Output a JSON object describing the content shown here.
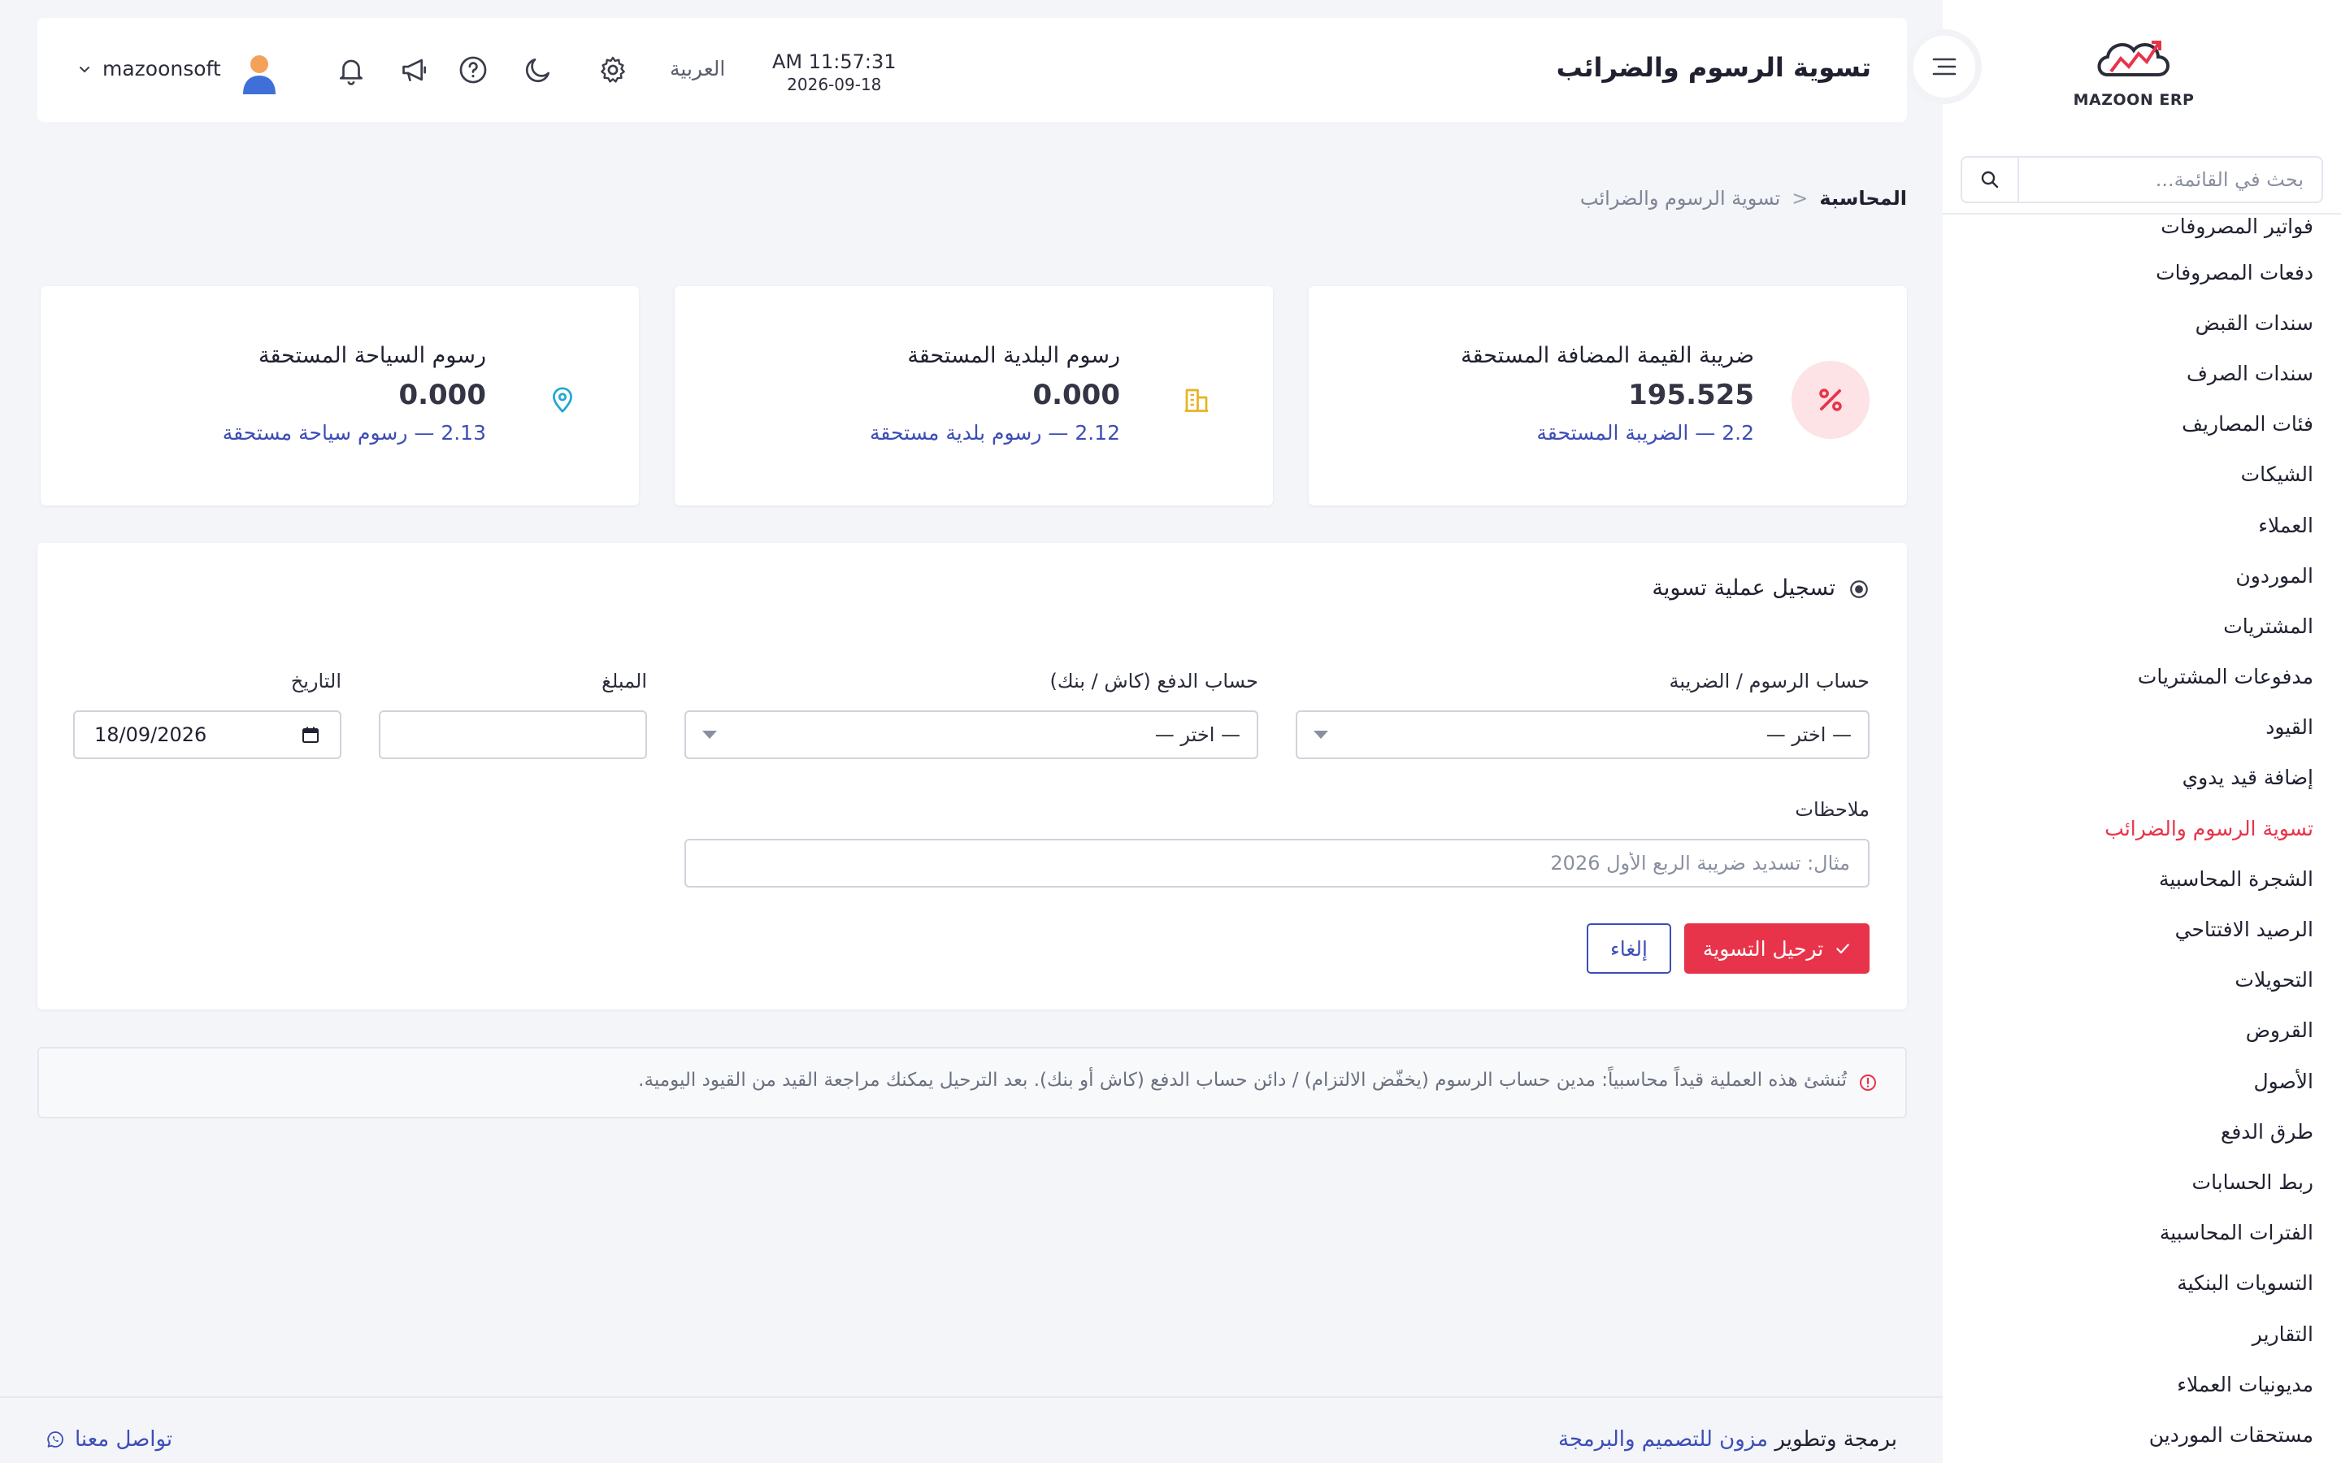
{
  "sidebar": {
    "logo_text": "MAZOON ERP",
    "search_placeholder": "بحث في القائمة...",
    "items": [
      {
        "label": "فواتير المصروفات"
      },
      {
        "label": "دفعات المصروفات"
      },
      {
        "label": "سندات القبض"
      },
      {
        "label": "سندات الصرف"
      },
      {
        "label": "فئات المصاريف"
      },
      {
        "label": "الشيكات"
      },
      {
        "label": "العملاء"
      },
      {
        "label": "الموردون"
      },
      {
        "label": "المشتريات"
      },
      {
        "label": "مدفوعات المشتريات"
      },
      {
        "label": "القيود"
      },
      {
        "label": "إضافة قيد يدوي"
      },
      {
        "label": "تسوية الرسوم والضرائب",
        "active": true
      },
      {
        "label": "الشجرة المحاسبية"
      },
      {
        "label": "الرصيد الافتتاحي"
      },
      {
        "label": "التحويلات"
      },
      {
        "label": "القروض"
      },
      {
        "label": "الأصول"
      },
      {
        "label": "طرق الدفع"
      },
      {
        "label": "ربط الحسابات"
      },
      {
        "label": "الفترات المحاسبية"
      },
      {
        "label": "التسويات البنكية"
      },
      {
        "label": "التقارير"
      },
      {
        "label": "مديونيات العملاء"
      },
      {
        "label": "مستحقات الموردين"
      }
    ]
  },
  "header": {
    "title": "تسوية الرسوم والضرائب",
    "time": "AM 11:57:31",
    "date": "2026-09-18",
    "language": "العربية",
    "username": "mazoonsoft"
  },
  "breadcrumb": {
    "root": "المحاسبة",
    "separator": "<",
    "current": "تسوية الرسوم والضرائب"
  },
  "cards": [
    {
      "title": "ضريبة القيمة المضافة المستحقة",
      "value": "195.525",
      "link": "2.2 — الضريبة المستحقة",
      "icon": "percent-icon"
    },
    {
      "title": "رسوم البلدية المستحقة",
      "value": "0.000",
      "link": "2.12 — رسوم بلدية مستحقة",
      "icon": "building-icon"
    },
    {
      "title": "رسوم السياحة المستحقة",
      "value": "0.000",
      "link": "2.13 — رسوم سياحة مستحقة",
      "icon": "map-pin-icon"
    }
  ],
  "form": {
    "title": "تسجيل عملية تسوية",
    "fee_account_label": "حساب الرسوم / الضريبة",
    "fee_account_value": "— اختر —",
    "payment_account_label": "حساب الدفع (كاش / بنك)",
    "payment_account_value": "— اختر —",
    "amount_label": "المبلغ",
    "amount_value": "",
    "date_label": "التاريخ",
    "date_value": "18/09/2026",
    "notes_label": "ملاحظات",
    "notes_placeholder": "مثال: تسديد ضريبة الربع الأول 2026",
    "submit_label": "ترحيل التسوية",
    "cancel_label": "إلغاء"
  },
  "note": {
    "text": "تُنشئ هذه العملية قيداً محاسبياً: مدين حساب الرسوم (يخفّض الالتزام) / دائن حساب الدفع (كاش أو بنك). بعد الترحيل يمكنك مراجعة القيد من القيود اليومية."
  },
  "footer": {
    "credit_prefix": "برمجة وتطوير",
    "credit_brand": "مزون للتصميم والبرمجة",
    "contact_label": "تواصل معنا"
  },
  "colors": {
    "accent": "#e8344a",
    "link": "#3d4db7",
    "background": "#f3f5f9",
    "vat_icon_bg": "#fde3e6",
    "municipal_icon": "#e6b422",
    "tourism_icon": "#1fa6d6"
  }
}
